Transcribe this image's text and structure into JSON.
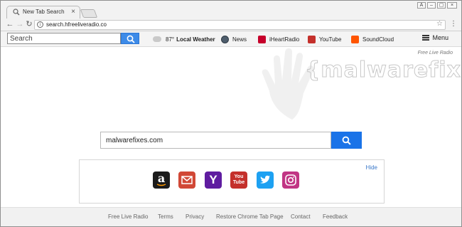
{
  "browser": {
    "tab_title": "New Tab Search",
    "url": "search.hfreeliveradio.co",
    "window_buttons": [
      "A",
      "–",
      "▢",
      "×"
    ]
  },
  "extension_bar": {
    "search_placeholder": "Search",
    "weather_temp": "87°",
    "weather_label": "Local Weather",
    "links": [
      {
        "label": "News",
        "icon": "news-icon"
      },
      {
        "label": "iHeartRadio",
        "icon": "iheartradio-icon"
      },
      {
        "label": "YouTube",
        "icon": "youtube-icon"
      },
      {
        "label": "SoundCloud",
        "icon": "soundcloud-icon"
      }
    ],
    "menu_label": "Menu"
  },
  "page": {
    "brand_corner": "Free Live Radio",
    "watermark": "{malwarefixes}",
    "search_value": "malwarefixes.com",
    "shortcuts_hide": "Hide",
    "shortcuts": [
      "amazon-icon",
      "gmail-icon",
      "yahoo-icon",
      "youtube-icon",
      "twitter-icon",
      "instagram-icon"
    ]
  },
  "footer": {
    "links": [
      "Free Live Radio",
      "Terms",
      "Privacy",
      "Restore Chrome Tab Page",
      "Contact",
      "Feedback"
    ]
  },
  "colors": {
    "accent_blue": "#1a73e8",
    "youtube_red": "#c4302b",
    "soundcloud_orange": "#ff5500",
    "iheart_red": "#c6002b"
  }
}
